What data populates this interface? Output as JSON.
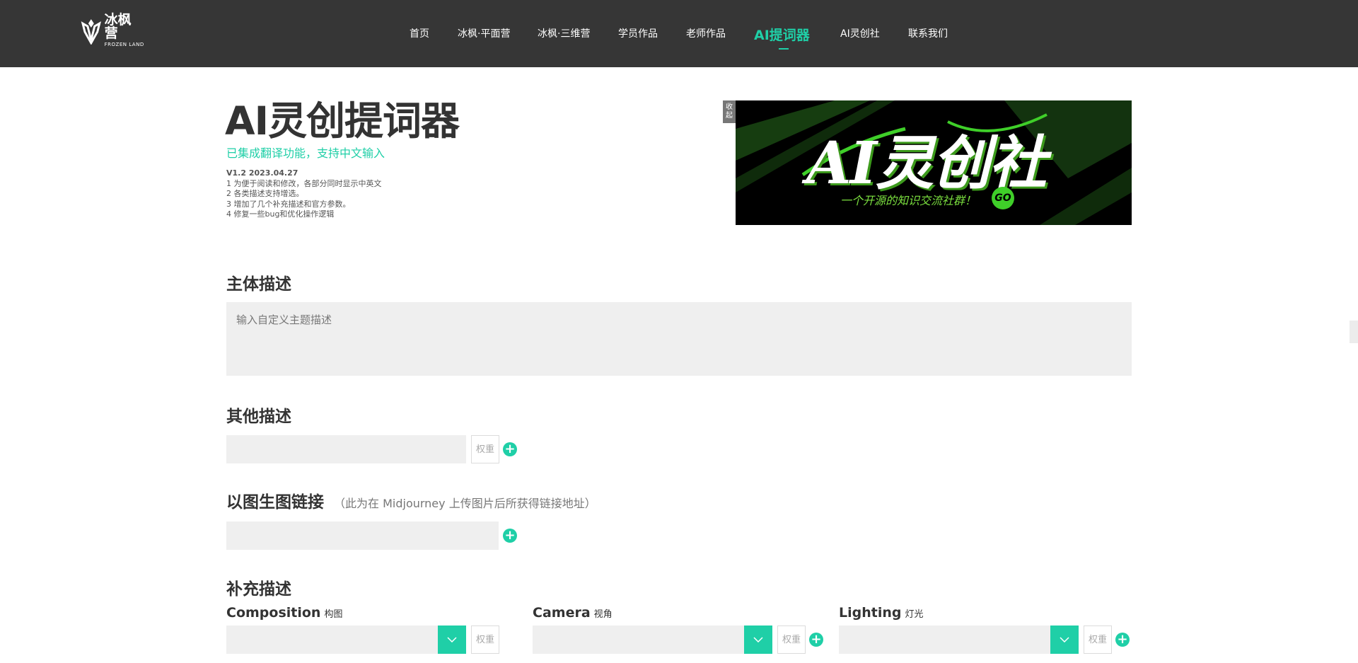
{
  "nav": {
    "logo_title": "冰枫营",
    "logo_sub": "FROZEN LAND",
    "items": [
      {
        "label": "首页"
      },
      {
        "label": "冰枫·平面营"
      },
      {
        "label": "冰枫·三维营"
      },
      {
        "label": "学员作品"
      },
      {
        "label": "老师作品"
      },
      {
        "label": "AI提词器"
      },
      {
        "label": "AI灵创社"
      },
      {
        "label": "联系我们"
      }
    ],
    "active_index": 5
  },
  "header": {
    "title": "AI灵创提词器",
    "subtitle": "已集成翻译功能，支持中文输入",
    "changelog": [
      "V1.2 2023.04.27",
      "1 为便于阅读和修改，各部分同时显示中英文",
      "2 各类描述支持增选。",
      "3 增加了几个补充描述和官方参数。",
      "4 修复一些bug和优化操作逻辑"
    ]
  },
  "banner": {
    "collapse_label_1": "收",
    "collapse_label_2": "起",
    "title": "AI灵创社",
    "slogan": "一个开源的知识交流社群！",
    "go_label": "GO"
  },
  "sections": {
    "main_desc": {
      "heading": "主体描述",
      "placeholder": "输入自定义主题描述"
    },
    "other_desc": {
      "heading": "其他描述",
      "weight_placeholder": "权重"
    },
    "image_link": {
      "heading": "以图生图链接",
      "note": "（此为在 Midjourney 上传图片后所获得链接地址）"
    },
    "supplement": {
      "heading": "补充描述",
      "weight_placeholder": "权重",
      "fields": [
        {
          "en": "Composition",
          "zh": "构图"
        },
        {
          "en": "Camera",
          "zh": "视角"
        },
        {
          "en": "Lighting",
          "zh": "灯光"
        }
      ]
    }
  },
  "colors": {
    "accent": "#1fcfa7",
    "nav_bg": "#363636",
    "input_bg": "#efefef"
  }
}
